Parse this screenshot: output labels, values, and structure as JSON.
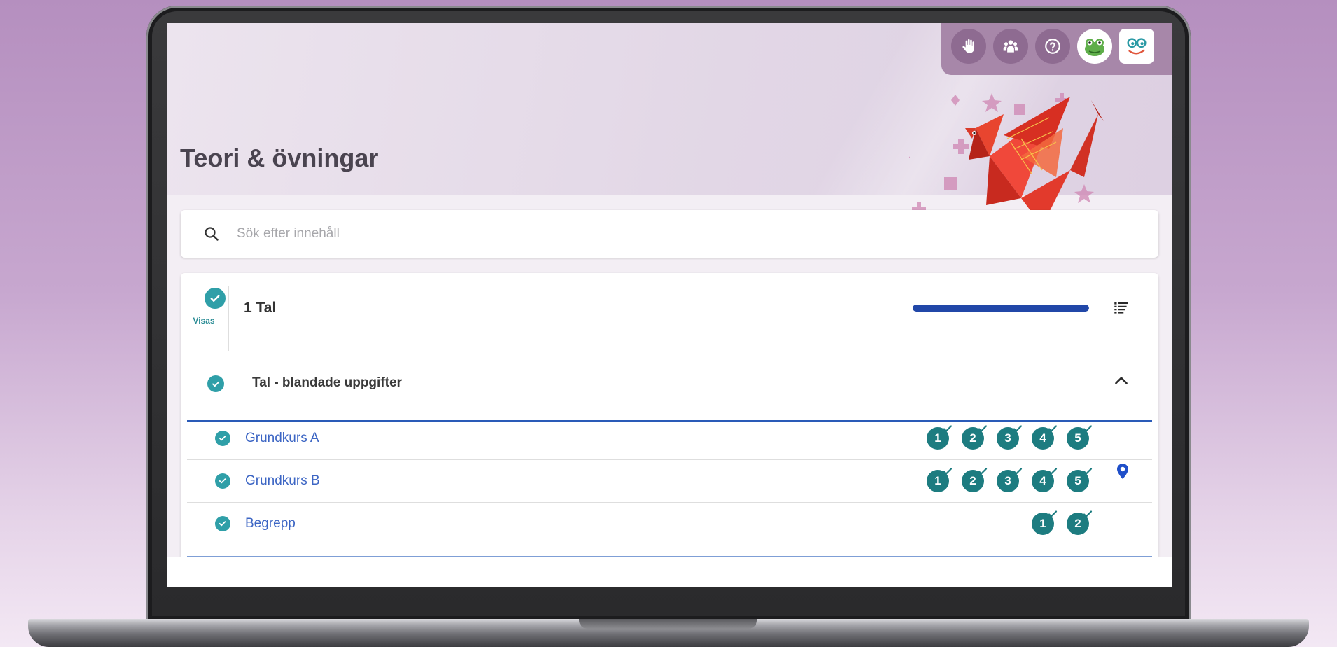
{
  "app": {
    "title": "Teori & övningar",
    "accent_color": "#2f9fa8",
    "link_color": "#3d66c4",
    "progress_color": "#2147a8"
  },
  "toolbar": {
    "buttons": [
      {
        "icon": "hand-icon"
      },
      {
        "icon": "group-icon"
      },
      {
        "icon": "help-icon"
      },
      {
        "icon": "frog-avatar-icon"
      },
      {
        "icon": "app-logo-icon"
      }
    ]
  },
  "search": {
    "placeholder": "Sök efter innehåll",
    "value": ""
  },
  "chapter": {
    "status_label": "Visas",
    "title": "1 Tal",
    "progress": 1.0,
    "menu_icon": "list-icon"
  },
  "section": {
    "title": "Tal - blandade uppgifter",
    "expanded": true
  },
  "rows": [
    {
      "label": "Grundkurs A",
      "levels": [
        "1",
        "2",
        "3",
        "4",
        "5"
      ],
      "current_location": true
    },
    {
      "label": "Grundkurs B",
      "levels": [
        "1",
        "2",
        "3",
        "4",
        "5"
      ],
      "current_location": false
    },
    {
      "label": "Begrepp",
      "levels": [
        "1",
        "2"
      ],
      "current_location": false
    }
  ]
}
